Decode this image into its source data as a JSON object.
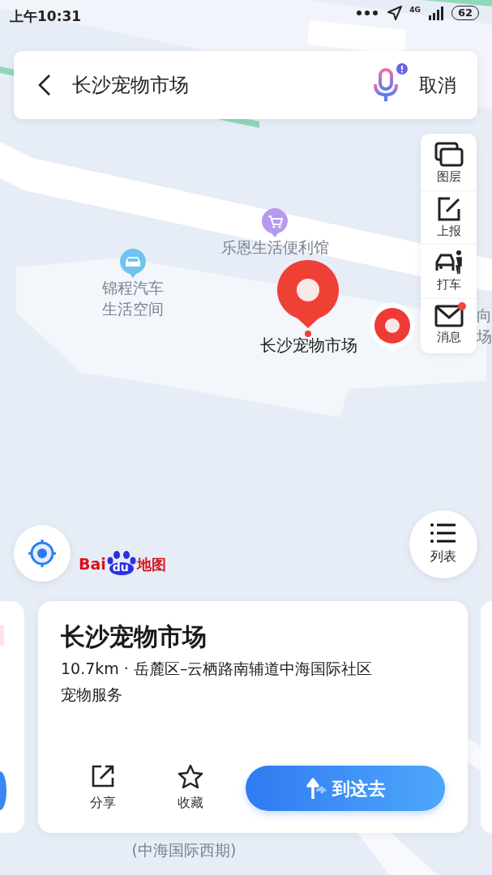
{
  "status_bar": {
    "time": "上午10:31",
    "network": "4G",
    "battery": "62"
  },
  "search": {
    "query": "长沙宠物市场",
    "cancel": "取消",
    "voice_alert": true
  },
  "toolbar": [
    {
      "label": "图层",
      "kind": "layers",
      "unread": false
    },
    {
      "label": "上报",
      "kind": "report",
      "unread": false
    },
    {
      "label": "打车",
      "kind": "taxi",
      "unread": false
    },
    {
      "label": "消息",
      "kind": "message",
      "unread": true
    }
  ],
  "map_labels": [
    {
      "text": "乐恩生活便利馆",
      "kind": "shop"
    },
    {
      "text": "锦程汽车",
      "kind": "car"
    },
    {
      "text": "生活空间",
      "kind": "plain"
    },
    {
      "text": "向",
      "kind": "plain"
    },
    {
      "text": "场",
      "kind": "plain"
    },
    {
      "text": "(中海国际西期)",
      "kind": "plain"
    }
  ],
  "selected_marker": {
    "label": "长沙宠物市场"
  },
  "logo": [
    "Bai",
    "du",
    "地图"
  ],
  "list_button": {
    "label": "列表"
  },
  "place_card": {
    "title": "长沙宠物市场",
    "address": "10.7km · 岳麓区–云栖路南辅道中海国际社区",
    "category": "宠物服务",
    "actions": [
      {
        "label": "分享",
        "kind": "share"
      },
      {
        "label": "收藏",
        "kind": "favorite"
      }
    ],
    "go_button": "到这去"
  }
}
